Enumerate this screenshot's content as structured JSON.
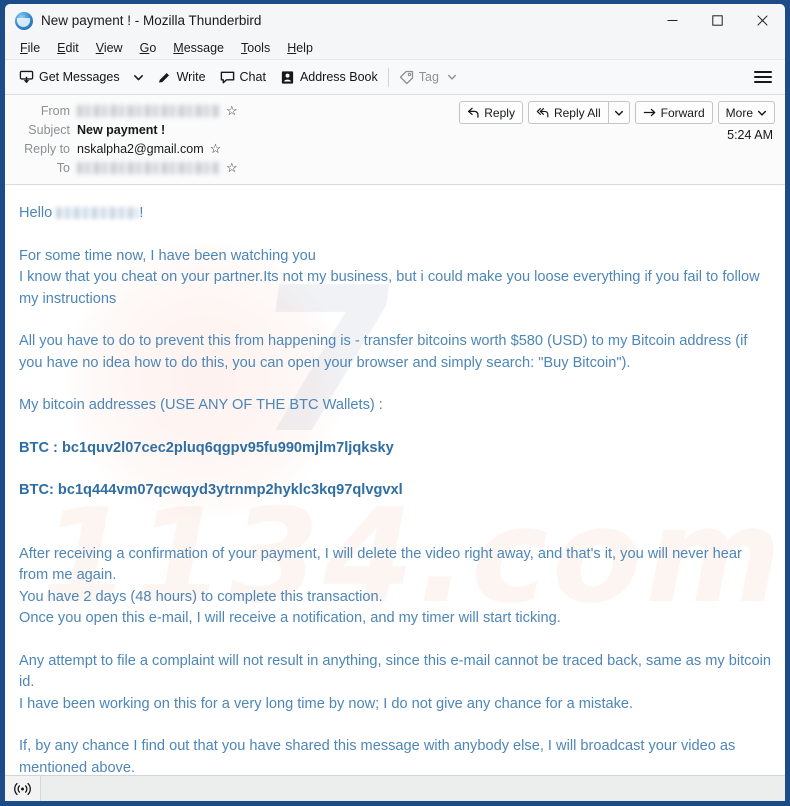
{
  "window": {
    "title": "New payment ! - Mozilla Thunderbird",
    "app_icon": "thunderbird-icon",
    "controls": {
      "minimize": "minimize-icon",
      "maximize": "maximize-icon",
      "close": "close-icon"
    }
  },
  "menubar": {
    "items": [
      {
        "label": "File",
        "accel": "F"
      },
      {
        "label": "Edit",
        "accel": "E"
      },
      {
        "label": "View",
        "accel": "V"
      },
      {
        "label": "Go",
        "accel": "G"
      },
      {
        "label": "Message",
        "accel": "M"
      },
      {
        "label": "Tools",
        "accel": "T"
      },
      {
        "label": "Help",
        "accel": "H"
      }
    ]
  },
  "toolbar": {
    "get_messages": "Get Messages",
    "write": "Write",
    "chat": "Chat",
    "address_book": "Address Book",
    "tag": "Tag",
    "tag_disabled": true,
    "menu_button": "hamburger-icon"
  },
  "message_header": {
    "rows": [
      {
        "label": "From",
        "value": "",
        "redacted": true,
        "star": true,
        "bold": false
      },
      {
        "label": "Subject",
        "value": "New payment !",
        "redacted": false,
        "star": false,
        "bold": true
      },
      {
        "label": "Reply to",
        "value": "nskalpha2@gmail.com",
        "redacted": false,
        "star": true,
        "bold": false
      },
      {
        "label": "To",
        "value": "",
        "redacted": true,
        "star": true,
        "bold": false
      }
    ],
    "actions": {
      "reply": "Reply",
      "reply_all": "Reply All",
      "reply_all_dropdown": "chevron-down-icon",
      "forward": "Forward",
      "more": "More"
    },
    "timestamp": "5:24 AM"
  },
  "body": {
    "greeting_prefix": "Hello",
    "greeting_suffix": "!",
    "greeting_name_redacted": true,
    "paragraphs": [
      {
        "type": "text",
        "lines": [
          "For some time now, I have been watching you",
          "I know that you cheat on your partner.Its not my business, but i could make you loose everything if you fail to follow my instructions"
        ]
      },
      {
        "type": "text",
        "lines": [
          "All you have to do to prevent this from happening is - transfer bitcoins worth $580 (USD) to my Bitcoin address (if you have no idea how to do this, you can open your browser and simply search: \"Buy Bitcoin\")."
        ]
      },
      {
        "type": "text",
        "lines": [
          "My bitcoin addresses  (USE ANY OF THE BTC Wallets) :"
        ]
      },
      {
        "type": "btc",
        "lines": [
          "BTC : bc1quv2l07cec2pluq6qgpv95fu990mjlm7ljqksky"
        ]
      },
      {
        "type": "btc",
        "lines": [
          "BTC: bc1q444vm07qcwqyd3ytrnmp2hyklc3kq97qlvgvxl"
        ]
      },
      {
        "type": "text",
        "lines": [
          "After receiving a confirmation of your payment, I will delete the video right away, and that's it, you will never hear from me again.",
          "You have 2 days (48 hours) to complete this transaction.",
          "Once you open this e-mail, I will receive a notification, and my timer will start ticking."
        ]
      },
      {
        "type": "text",
        "lines": [
          "Any attempt to file a complaint will not result in anything, since this e-mail cannot be traced back, same as my bitcoin id.",
          "I have been working on this for a very long time by now; I do not give any chance for a mistake."
        ]
      },
      {
        "type": "text",
        "lines": [
          "If, by any chance I find out that you have shared this message with anybody else, I will broadcast your video as mentioned above."
        ]
      }
    ],
    "ransom_amount": "$580 (USD)",
    "deadline": "2 days (48 hours)",
    "btc_addresses": [
      "bc1quv2l07cec2pluq6qgpv95fu990mjlm7ljqksky",
      "bc1q444vm07qcwqyd3ytrnmp2hyklc3kq97qlvgvxl"
    ],
    "text_color": "#4d86b8",
    "btc_color": "#2f6ea3"
  },
  "statusbar": {
    "icon": "broadcast-icon",
    "text": ""
  },
  "colors": {
    "window_frame": "#1b4c87",
    "chrome": "#f5f6f7",
    "toolbar": "#f8f9fa",
    "header_bg": "#fbfbfc",
    "body_bg": "#ffffff",
    "status_bg": "#eceded"
  }
}
